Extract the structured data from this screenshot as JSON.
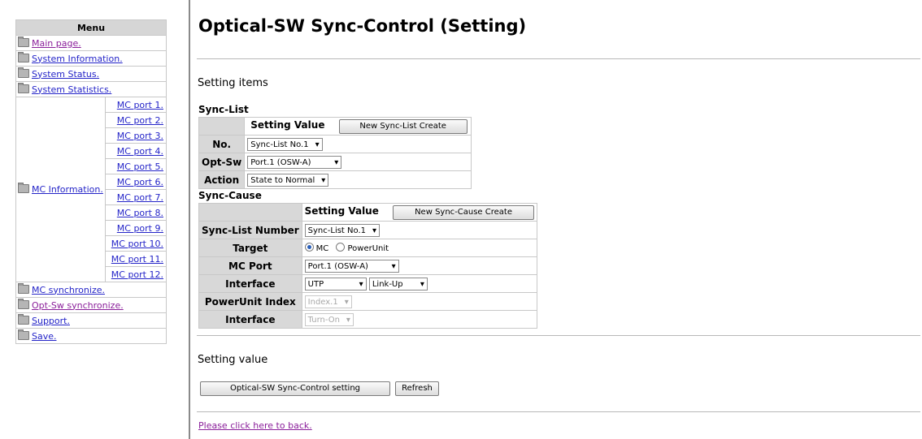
{
  "menu": {
    "header": "Menu",
    "items": [
      {
        "label": "Main page."
      },
      {
        "label": "System Information."
      },
      {
        "label": "System Status."
      },
      {
        "label": "System Statistics."
      }
    ],
    "mc_information": "MC Information.",
    "mc_ports": [
      "MC port 1.",
      "MC port 2.",
      "MC port 3.",
      "MC port 4.",
      "MC port 5.",
      "MC port 6.",
      "MC port 7.",
      "MC port 8.",
      "MC port 9.",
      "MC port 10.",
      "MC port 11.",
      "MC port 12."
    ],
    "items_after": [
      {
        "label": "MC synchronize."
      },
      {
        "label": "Opt-Sw synchronize."
      },
      {
        "label": "Support."
      },
      {
        "label": "Save."
      }
    ]
  },
  "page": {
    "title": "Optical-SW Sync-Control (Setting)",
    "setting_items": "Setting items",
    "setting_value": "Setting value",
    "back_link": "Please click here to back."
  },
  "sync_list": {
    "label": "Sync-List",
    "col_header": "Setting Value",
    "create_button": "New Sync-List Create",
    "rows": {
      "no_label": "No.",
      "no_value": "Sync-List No.1",
      "optsw_label": "Opt-Sw",
      "optsw_value": "Port.1 (OSW-A)",
      "action_label": "Action",
      "action_value": "State to Normal"
    }
  },
  "sync_cause": {
    "label": "Sync-Cause",
    "col_header": "Setting Value",
    "create_button": "New Sync-Cause Create",
    "rows": {
      "list_number_label": "Sync-List Number",
      "list_number_value": "Sync-List No.1",
      "target_label": "Target",
      "target_opt1": "MC",
      "target_opt2": "PowerUnit",
      "mcport_label": "MC Port",
      "mcport_value": "Port.1 (OSW-A)",
      "interface_label": "Interface",
      "interface_value1": "UTP",
      "interface_value2": "Link-Up",
      "pu_index_label": "PowerUnit Index",
      "pu_index_value": "Index.1",
      "interface2_label": "Interface",
      "interface2_value": "Turn-On"
    }
  },
  "buttons": {
    "setting": "Optical-SW Sync-Control setting",
    "refresh": "Refresh"
  }
}
